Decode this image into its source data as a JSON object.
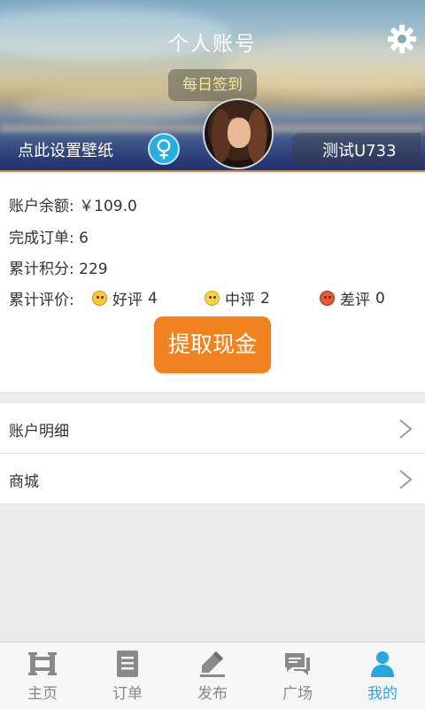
{
  "header": {
    "title": "个人账号",
    "sign_in_label": "每日签到",
    "wallpaper_label": "点此设置壁纸",
    "gender_symbol": "♀",
    "username": "测试U733",
    "icons": {
      "settings": "gear-icon",
      "gender": "female-icon",
      "avatar": "user-avatar"
    }
  },
  "info": {
    "balance_label": "账户余额:",
    "balance_value": "￥109.0",
    "orders_label": "完成订单:",
    "orders_value": "6",
    "points_label": "累计积分:",
    "points_value": "229",
    "rating_label": "累计评价:",
    "ratings": [
      {
        "label": "好评",
        "count": "4",
        "icon": "happy-face-icon"
      },
      {
        "label": "中评",
        "count": "2",
        "icon": "neutral-face-icon"
      },
      {
        "label": "差评",
        "count": "0",
        "icon": "angry-face-icon"
      }
    ],
    "withdraw_label": "提取现金"
  },
  "menu": {
    "items": [
      {
        "label": "账户明细"
      },
      {
        "label": "商城"
      }
    ]
  },
  "tabs": [
    {
      "label": "主页",
      "icon": "home-icon"
    },
    {
      "label": "订单",
      "icon": "order-icon"
    },
    {
      "label": "发布",
      "icon": "publish-icon"
    },
    {
      "label": "广场",
      "icon": "square-chat-icon"
    },
    {
      "label": "我的",
      "icon": "profile-icon",
      "active": true
    }
  ],
  "colors": {
    "accent": "#f0821f",
    "tab_active": "#29a8e0",
    "tab_inactive": "#888888",
    "gender_badge": "#29aee3"
  }
}
